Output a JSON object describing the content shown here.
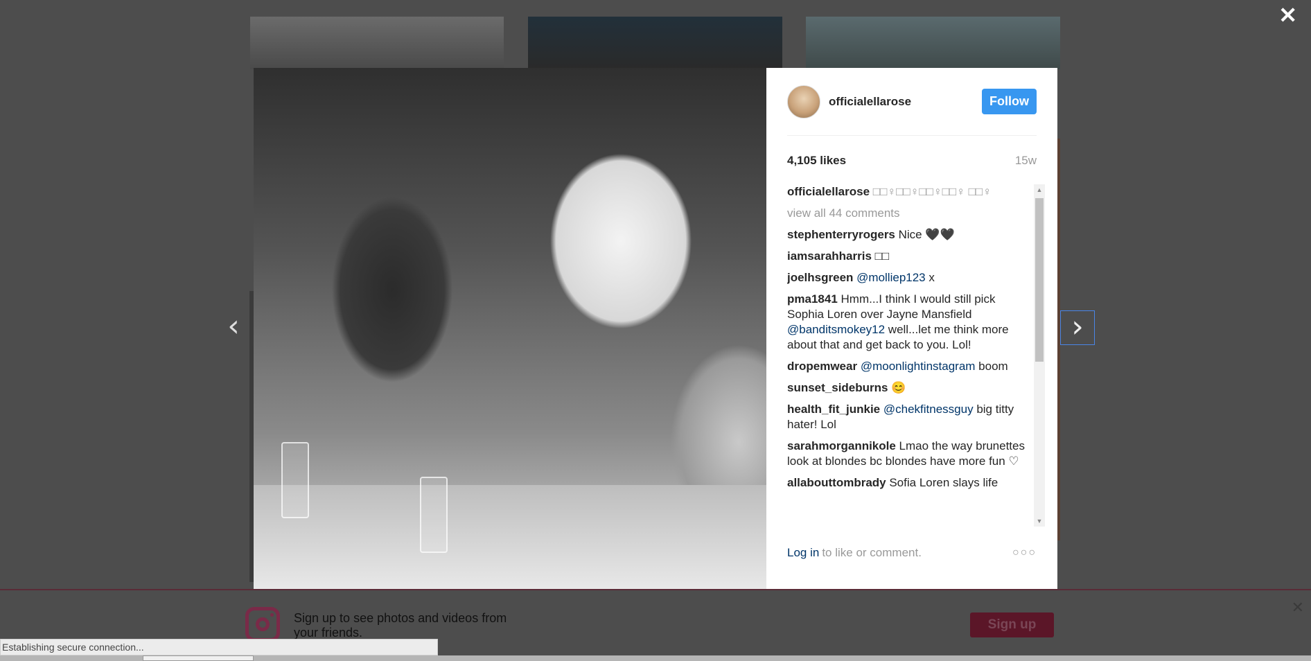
{
  "modal": {
    "username": "officialellarose",
    "follow_label": "Follow",
    "likes": "4,105 likes",
    "age": "15w",
    "caption_user": "officialellarose",
    "caption_text": "□□♀□□♀□□♀□□♀ □□♀",
    "view_all": "view all 44 comments",
    "comments": [
      {
        "user": "stephenterryrogers",
        "segments": [
          {
            "t": " Nice 🖤🖤",
            "mention": false
          }
        ]
      },
      {
        "user": "iamsarahharris",
        "segments": [
          {
            "t": " □□",
            "mention": false
          }
        ]
      },
      {
        "user": "joelhsgreen",
        "segments": [
          {
            "t": " ",
            "mention": false
          },
          {
            "t": "@molliep123",
            "mention": true
          },
          {
            "t": " x",
            "mention": false
          }
        ]
      },
      {
        "user": "pma1841",
        "segments": [
          {
            "t": " Hmm...I think I would still pick Sophia Loren over Jayne Mansfield ",
            "mention": false
          },
          {
            "t": "@banditsmokey12",
            "mention": true
          },
          {
            "t": " well...let me think more about that and get back to you. Lol!",
            "mention": false
          }
        ]
      },
      {
        "user": "dropemwear",
        "segments": [
          {
            "t": " ",
            "mention": false
          },
          {
            "t": "@moonlightinstagram",
            "mention": true
          },
          {
            "t": " boom",
            "mention": false
          }
        ]
      },
      {
        "user": "sunset_sideburns",
        "segments": [
          {
            "t": " 😊",
            "mention": false
          }
        ]
      },
      {
        "user": "health_fit_junkie",
        "segments": [
          {
            "t": " ",
            "mention": false
          },
          {
            "t": "@chekfitnessguy",
            "mention": true
          },
          {
            "t": " big titty hater! Lol",
            "mention": false
          }
        ]
      },
      {
        "user": "sarahmorgannikole",
        "segments": [
          {
            "t": " Lmao the way brunettes look at blondes bc blondes have more fun ♡",
            "mention": false
          }
        ]
      },
      {
        "user": "allabouttombrady",
        "segments": [
          {
            "t": " Sofia Loren slays life",
            "mention": false
          }
        ]
      }
    ],
    "login_label": "Log in",
    "login_rest": "to like or comment.",
    "more_label": "○○○"
  },
  "close_label": "✕",
  "nav": {
    "prev": "‹",
    "next": "›"
  },
  "banner": {
    "text": "Sign up to see photos and videos from your friends.",
    "signup_label": "Sign up",
    "close_label": "✕"
  },
  "status_text": "Establishing secure connection...",
  "colors": {
    "follow": "#3897f0",
    "mention": "#003569",
    "muted": "#999999"
  }
}
